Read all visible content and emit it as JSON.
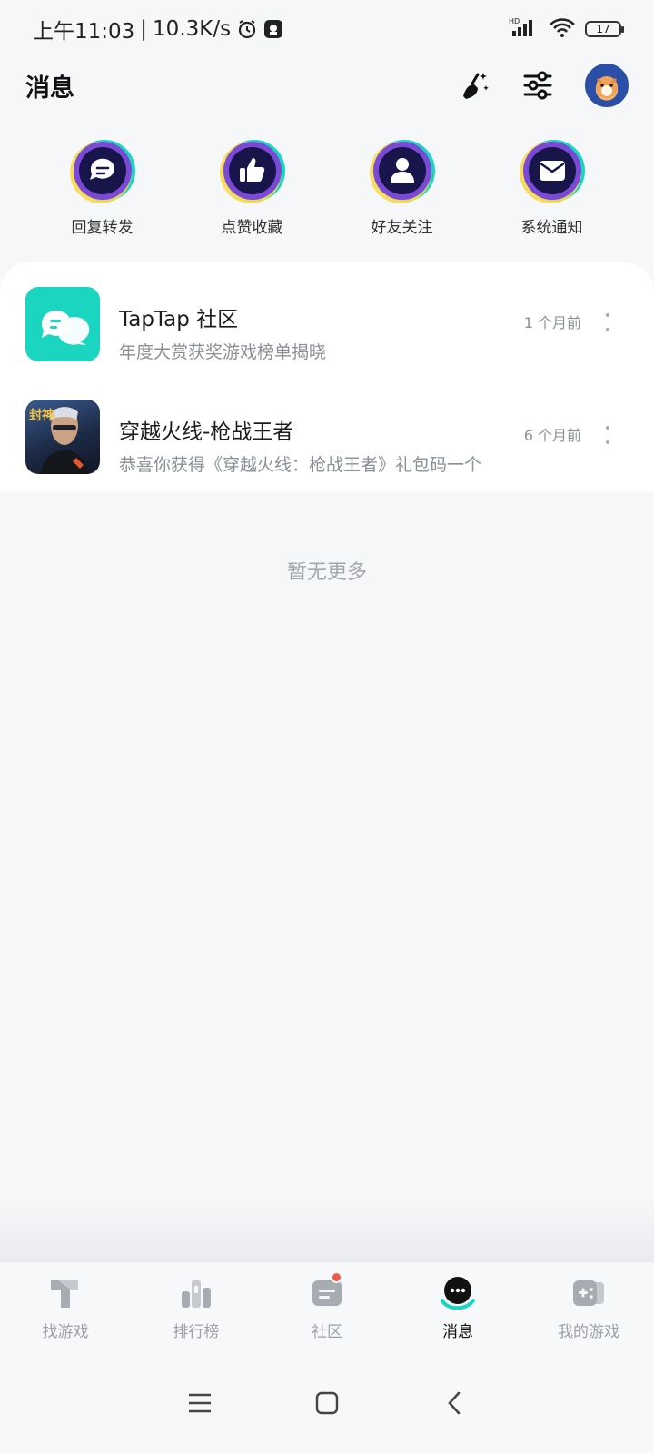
{
  "status_bar": {
    "time": "上午11:03",
    "separator": "|",
    "net_speed": "10.3K/s",
    "battery": "17",
    "signal_label": "HD"
  },
  "header": {
    "title": "消息"
  },
  "categories": [
    {
      "label": "回复转发",
      "icon": "reply-forward-icon"
    },
    {
      "label": "点赞收藏",
      "icon": "like-icon"
    },
    {
      "label": "好友关注",
      "icon": "friend-icon"
    },
    {
      "label": "系统通知",
      "icon": "mail-icon"
    }
  ],
  "messages": [
    {
      "title": "TapTap 社区",
      "subtitle": "年度大赏获奖游戏榜单揭晓",
      "time": "1 个月前"
    },
    {
      "title": "穿越火线-枪战王者",
      "subtitle": "恭喜你获得《穿越火线：枪战王者》礼包码一个",
      "time": "6 个月前",
      "thumb_text": "封神"
    }
  ],
  "empty_hint": "暂无更多",
  "bottom_nav": [
    {
      "label": "找游戏",
      "icon": "find-games-icon"
    },
    {
      "label": "排行榜",
      "icon": "ranking-icon"
    },
    {
      "label": "社区",
      "icon": "community-icon"
    },
    {
      "label": "消息",
      "icon": "messages-icon"
    },
    {
      "label": "我的游戏",
      "icon": "my-games-icon"
    }
  ],
  "colors": {
    "accent": "#1ad6c0",
    "dark_navy": "#17154a",
    "badge": "#f15a4a"
  }
}
